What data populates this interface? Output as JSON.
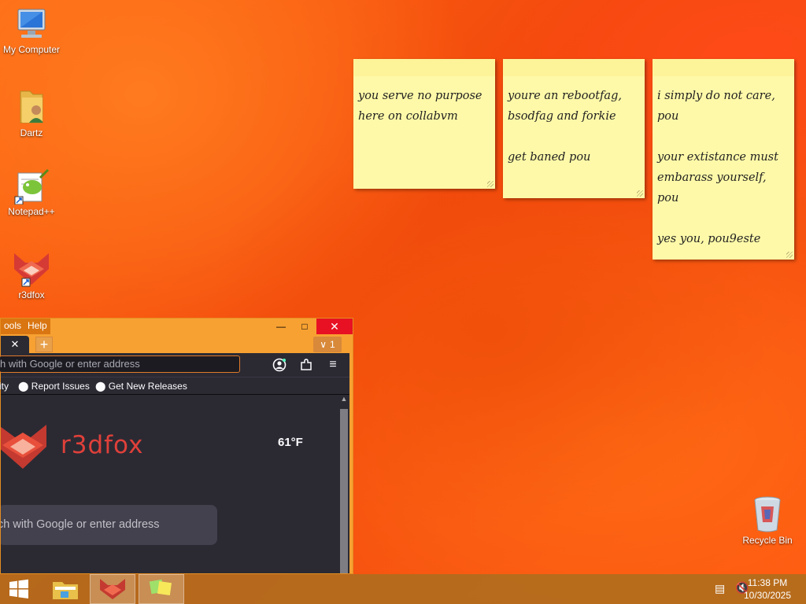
{
  "desktop": {
    "icons": [
      {
        "label": "My Computer",
        "icon": "my-computer-icon"
      },
      {
        "label": "Dartz",
        "icon": "user-folder-icon"
      },
      {
        "label": "Notepad++",
        "icon": "notepadpp-icon"
      },
      {
        "label": "r3dfox",
        "icon": "r3dfox-icon"
      },
      {
        "label": "Recycle Bin",
        "icon": "recycle-bin-icon"
      }
    ]
  },
  "notes": [
    {
      "text": "you serve no purpose\nhere on collabvm"
    },
    {
      "text": "youre an rebootfag,\nbsodfag and forkie\n\nget baned pou"
    },
    {
      "text": "i simply do not care,\npou\n\nyour extistance must\nembarass yourself,\npou\n\nyes you, pou9este"
    }
  ],
  "browser": {
    "menu": {
      "tools": "ools",
      "help": "Help"
    },
    "controls": {
      "minimize": "—",
      "maximize": "□",
      "close": "✕"
    },
    "tab": {
      "close": "✕",
      "add": "+",
      "list_count": "1"
    },
    "url_placeholder": "h with Google or enter address",
    "bookmarks": {
      "item1": "ity",
      "item2": "Report Issues",
      "item3": "Get New Releases"
    },
    "newtab": {
      "brand": "r3dfox",
      "weather": "61°F",
      "search_placeholder": "ch with Google or enter address"
    }
  },
  "taskbar": {
    "apps": [
      "start-icon",
      "file-explorer-icon",
      "r3dfox-icon",
      "sticky-notes-icon"
    ],
    "time": "11:38 PM",
    "date": "10/30/2025"
  }
}
